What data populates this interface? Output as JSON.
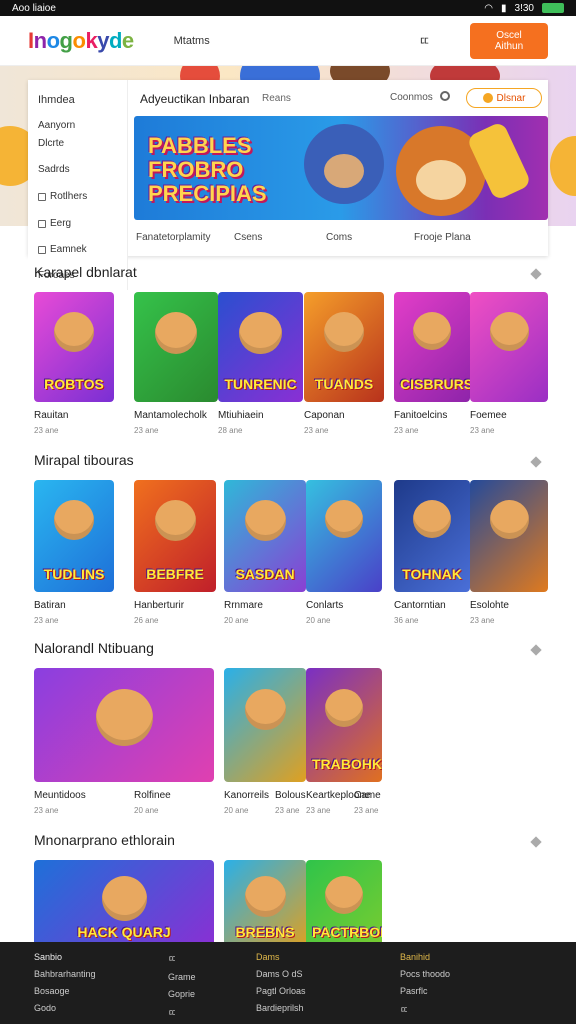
{
  "status": {
    "app": "Aoo liaioe",
    "right": "3!30"
  },
  "header": {
    "logo": "Inogokyde",
    "nav": "Mtatms",
    "icon_label": "ㄸ",
    "cta": "Oscel Aithun"
  },
  "sidebar": {
    "title": "Ihmdea",
    "items": [
      {
        "label": "Aanyorn",
        "icon": false
      },
      {
        "label": "Dlcrte",
        "icon": false
      },
      {
        "label": "Sadrds",
        "icon": false
      },
      {
        "label": "Rotlhers",
        "icon": true
      },
      {
        "label": "Eerg",
        "icon": true
      },
      {
        "label": "Eamnek",
        "icon": true
      },
      {
        "label": "Foroaes",
        "icon": false
      }
    ]
  },
  "panel": {
    "title": "Adyeuctikan Inbaran",
    "sub": "Reans",
    "right": "Coonmos",
    "pill": "Dlsnar",
    "banner_title": "PABBLES FROBRO PRECIPIAS",
    "tabs": [
      "Fanatetorplamity",
      "Csens",
      "Coms",
      "Frooje Plana"
    ]
  },
  "sections": [
    {
      "title": "Karapel dbnlarat",
      "cards": [
        {
          "label": "Rauitan",
          "meta": "23 ane",
          "word": "ROBTOS",
          "c1": "#e84bd6",
          "c2": "#7a2fd4"
        },
        {
          "label": "Mantamolecholk",
          "meta": "23 ane",
          "word": "",
          "c1": "#35c24a",
          "c2": "#2a8a2f"
        },
        {
          "label": "Mtiuhiaein",
          "meta": "28 ane",
          "word": "TUNRENIC",
          "c1": "#2a4fd0",
          "c2": "#8a2fd4"
        },
        {
          "label": "Caponan",
          "meta": "23 ane",
          "word": "TUANDS",
          "c1": "#f59e2a",
          "c2": "#b8321c"
        },
        {
          "label": "Fanitoelcins",
          "meta": "23 ane",
          "word": "CISBRURS",
          "c1": "#e33ec8",
          "c2": "#8e24aa"
        },
        {
          "label": "Foemee",
          "meta": "23 ane",
          "word": "",
          "c1": "#f04fc4",
          "c2": "#9a2fc4"
        }
      ]
    },
    {
      "title": "Mirapal tibouras",
      "cards": [
        {
          "label": "Batiran",
          "meta": "23 ane",
          "word": "TUDLINS",
          "c1": "#2ab6f0",
          "c2": "#1e6fd8"
        },
        {
          "label": "Hanberturir",
          "meta": "26 ane",
          "word": "BEBFRE",
          "c1": "#f0701e",
          "c2": "#c01f2a"
        },
        {
          "label": "Rrnmare",
          "meta": "20 ane",
          "word": "SASDAN",
          "c1": "#2fb8d8",
          "c2": "#8a3fd4"
        },
        {
          "label": "Conlarts",
          "meta": "20 ane",
          "word": "",
          "c1": "#35c0e0",
          "c2": "#4a40c8"
        },
        {
          "label": "Cantorntian",
          "meta": "36 ane",
          "word": "TOHNAK",
          "c1": "#1e3a8a",
          "c2": "#4a6fd8"
        },
        {
          "label": "Esolohte",
          "meta": "23 ane",
          "word": "",
          "c1": "#244a9a",
          "c2": "#e07a1e"
        }
      ]
    },
    {
      "title": "Nalorandl Ntibuang",
      "cards": [
        {
          "label": "Meuntidoos",
          "meta": "23 ane",
          "word": "",
          "c1": "#8a3fe0",
          "c2": "#e040b0"
        },
        {
          "label": "Rolfinee",
          "meta": "20 ane",
          "word": "",
          "c1": "#ffffff",
          "c2": "#ffffff"
        },
        {
          "label": "Kanorreils",
          "meta": "20 ane",
          "word": "",
          "c1": "#2ab0e8",
          "c2": "#e0a020"
        },
        {
          "label": "Bolous",
          "meta": "23 ane",
          "word": "",
          "c1": "#ffffff",
          "c2": "#ffffff"
        },
        {
          "label": "Keartkeploone",
          "meta": "23 ane",
          "word": "TRABOHKS",
          "c1": "#7a2fc4",
          "c2": "#e07020"
        },
        {
          "label": "Came",
          "meta": "23 ane",
          "word": "",
          "c1": "#ffffff",
          "c2": "#ffffff"
        }
      ]
    },
    {
      "title": "Mnonarprano ethlorain",
      "cards": [
        {
          "label": "",
          "meta": "",
          "word": "HACK QUARJ",
          "c1": "#1e70d8",
          "c2": "#8a2fd4"
        },
        {
          "label": "",
          "meta": "",
          "word": "",
          "c1": "#ffffff",
          "c2": "#ffffff"
        },
        {
          "label": "",
          "meta": "",
          "word": "BREBNS",
          "c1": "#2ab0e8",
          "c2": "#e0a020"
        },
        {
          "label": "",
          "meta": "",
          "word": "",
          "c1": "#ffffff",
          "c2": "#ffffff"
        },
        {
          "label": "",
          "meta": "",
          "word": "PACTRBOES",
          "c1": "#2fc44a",
          "c2": "#7acc30"
        },
        {
          "label": "",
          "meta": "",
          "word": "",
          "c1": "#ffffff",
          "c2": "#ffffff"
        }
      ]
    }
  ],
  "footer": {
    "col1": [
      "Sanbio",
      "Bahbrarhanting",
      "Bosaoge",
      "Godo"
    ],
    "col2": [
      "ㄸ",
      "Grame",
      "Goprie",
      "ㄸ"
    ],
    "col3": [
      "Dams",
      "Dams O dS",
      "Pagtl Orloas",
      "Bardieprilsh"
    ],
    "col4": [
      "Banihid",
      "Pocs thoodo",
      "Pasrflc",
      "ㄸ"
    ]
  }
}
